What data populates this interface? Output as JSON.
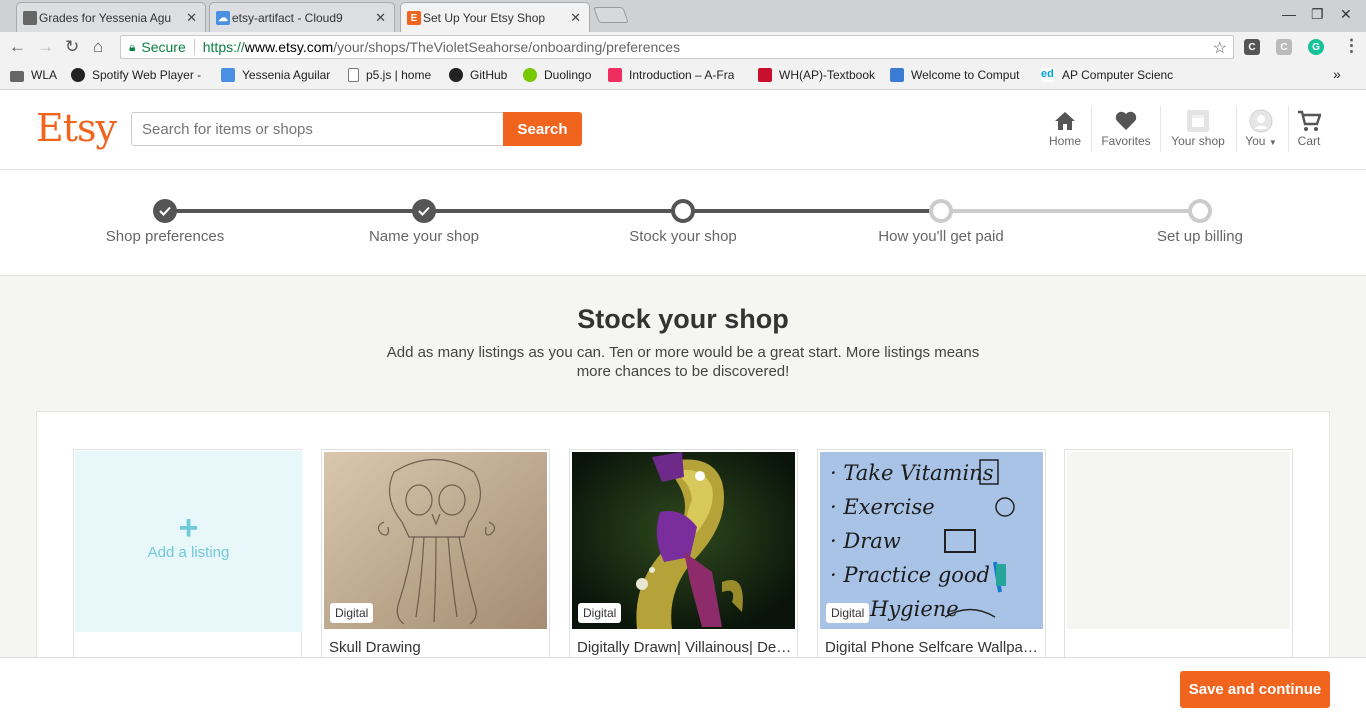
{
  "browser": {
    "tabs": [
      {
        "title": "Grades for Yessenia Agu",
        "favicon": "doc-icon",
        "color": "#666666"
      },
      {
        "title": "etsy-artifact - Cloud9",
        "favicon": "cloud9-icon",
        "color": "#4a90e2"
      },
      {
        "title": "Set Up Your Etsy Shop",
        "favicon": "etsy-icon",
        "color": "#f1641e"
      }
    ],
    "address": {
      "secure_label": "Secure",
      "protocol": "https://",
      "host": "www.etsy.com",
      "path": "/your/shops/TheVioletSeahorse/onboarding/preferences"
    },
    "bookmarks": [
      {
        "label": "WLA",
        "icon": "folder-icon"
      },
      {
        "label": "Spotify Web Player -",
        "icon": "spotify-icon"
      },
      {
        "label": "Yessenia Aguilar",
        "icon": "cloud9-icon"
      },
      {
        "label": "p5.js | home",
        "icon": "page-icon"
      },
      {
        "label": "GitHub",
        "icon": "github-icon"
      },
      {
        "label": "Duolingo",
        "icon": "duolingo-icon"
      },
      {
        "label": "Introduction – A-Fra",
        "icon": "aframe-icon"
      },
      {
        "label": "WH(AP)-Textbook",
        "icon": "textbook-icon"
      },
      {
        "label": "Welcome to Comput",
        "icon": "course-icon"
      },
      {
        "label": "AP Computer Scienc",
        "icon": "edx-icon"
      }
    ],
    "bookmarks_overflow": "»"
  },
  "header": {
    "logo": "Etsy",
    "search": {
      "placeholder": "Search for items or shops",
      "button": "Search"
    },
    "nav": {
      "home": "Home",
      "favorites": "Favorites",
      "your_shop": "Your shop",
      "you": "You",
      "cart": "Cart"
    }
  },
  "steps": [
    {
      "label": "Shop preferences",
      "state": "done"
    },
    {
      "label": "Name your shop",
      "state": "done"
    },
    {
      "label": "Stock your shop",
      "state": "current"
    },
    {
      "label": "How you'll get paid",
      "state": "todo"
    },
    {
      "label": "Set up billing",
      "state": "todo"
    }
  ],
  "main": {
    "title": "Stock your shop",
    "subtitle": "Add as many listings as you can. Ten or more would be a great start. More listings means more chances to be discovered!",
    "add_listing": {
      "plus": "+",
      "label": "Add a listing"
    },
    "listings": [
      {
        "title": "Skull Drawing",
        "badge": "Digital"
      },
      {
        "title": "Digitally Drawn| Villainous| Demon",
        "badge": "Digital"
      },
      {
        "title": "Digital Phone Selfcare Wallpaper",
        "badge": "Digital",
        "thumb_text": [
          "· Take Vitamins",
          "· Exercise",
          "· Draw",
          "· Practice good",
          "Hygiene"
        ]
      }
    ]
  },
  "footer": {
    "save_button": "Save and continue"
  },
  "colors": {
    "brand": "#f1641e",
    "step_done": "#555555",
    "step_todo": "#cccccc",
    "add_tint": "#71c9dc"
  }
}
